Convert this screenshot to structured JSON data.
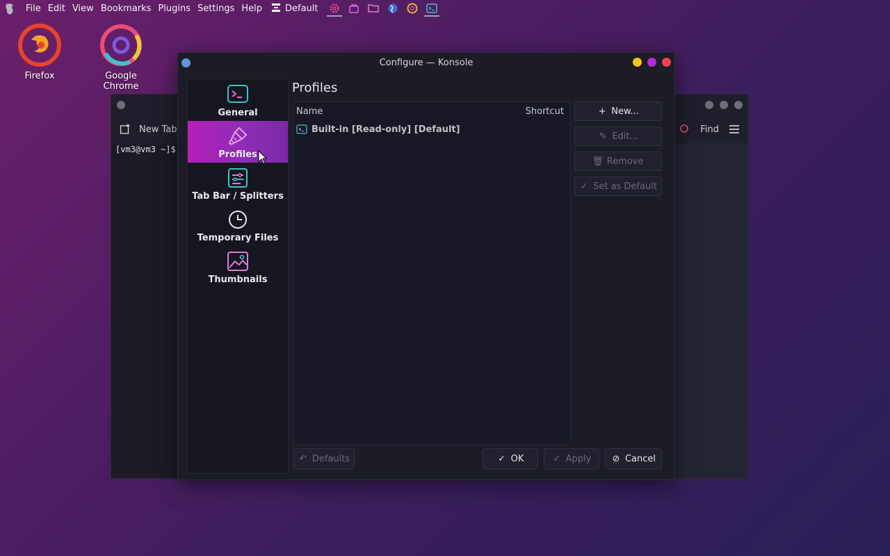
{
  "topbar": {
    "menus": [
      "File",
      "Edit",
      "View",
      "Bookmarks",
      "Plugins",
      "Settings",
      "Help"
    ],
    "default_label": "Default"
  },
  "desktop": {
    "icons": [
      {
        "label": "Firefox"
      },
      {
        "label": "Google Chrome"
      }
    ]
  },
  "background_window": {
    "new_tab_label": "New Tab",
    "find_label": "Find",
    "prompt": "[vm3@vm3 ~]$"
  },
  "dialog": {
    "title": "Configure — Konsole",
    "sidebar": {
      "items": [
        {
          "label": "General",
          "icon": "terminal-icon"
        },
        {
          "label": "Profiles",
          "icon": "brush-icon",
          "selected": true
        },
        {
          "label": "Tab Bar / Splitters",
          "icon": "tabbar-icon"
        },
        {
          "label": "Temporary Files",
          "icon": "clock-icon"
        },
        {
          "label": "Thumbnails",
          "icon": "image-icon"
        }
      ]
    },
    "page_title": "Profiles",
    "table": {
      "columns": [
        "Name",
        "Shortcut"
      ],
      "rows": [
        {
          "name": "Built-in [Read-only] [Default]",
          "shortcut": ""
        }
      ]
    },
    "actions": {
      "new": "New...",
      "edit": "Edit...",
      "remove": "Remove",
      "set_default": "Set as Default"
    },
    "footer": {
      "defaults": "Defaults",
      "ok": "OK",
      "apply": "Apply",
      "cancel": "Cancel"
    }
  },
  "colors": {
    "accent": "#b41fb6",
    "icon_teal": "#3ec3c9",
    "icon_pink": "#e37ad8",
    "close": "#f0424d",
    "minimize": "#f6c41a",
    "maximize": "#b62ad6"
  }
}
